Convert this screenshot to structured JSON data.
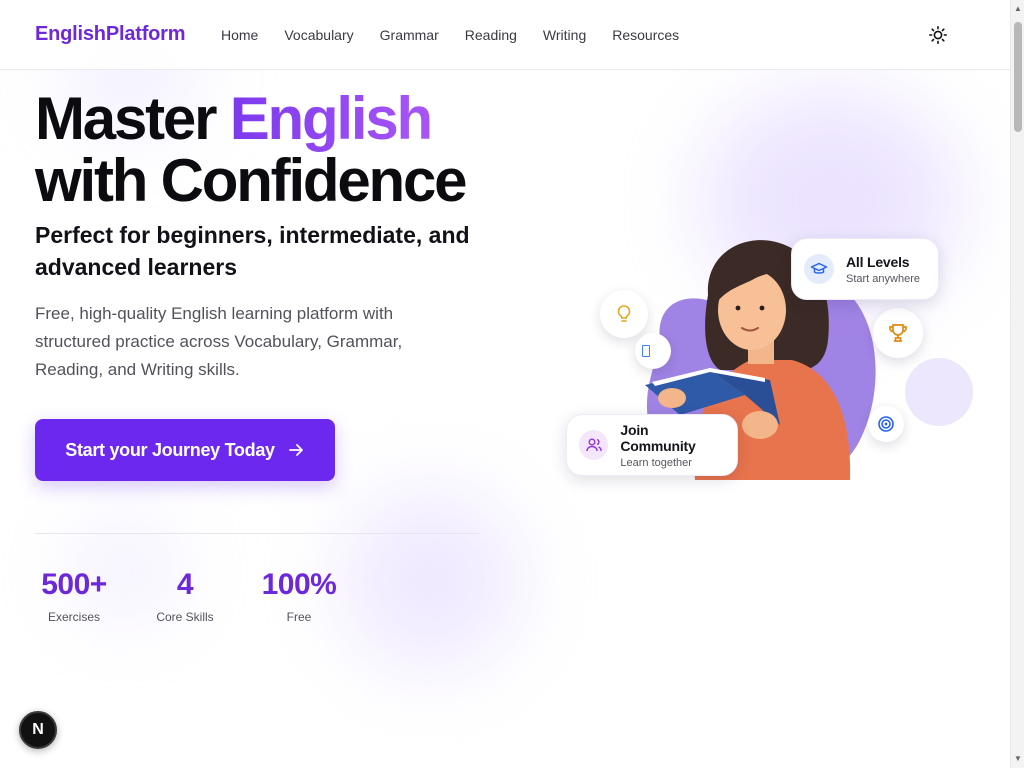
{
  "nav": {
    "brand": "EnglishPlatform",
    "links": [
      "Home",
      "Vocabulary",
      "Grammar",
      "Reading",
      "Writing",
      "Resources"
    ],
    "theme_toggle_icon": "sun-icon"
  },
  "hero": {
    "title_line1_plain": "Master ",
    "title_line1_accent": "English",
    "title_line2": "with Confidence",
    "subtitle": "Perfect for beginners, intermediate, and advanced learners",
    "description": "Free, high-quality English learning platform with structured practice across Vocabulary, Grammar, Reading, and Writing skills.",
    "cta_label": "Start your Journey Today",
    "cta_icon": "arrow-right-icon"
  },
  "stats": [
    {
      "value": "500+",
      "label": "Exercises"
    },
    {
      "value": "4",
      "label": "Core Skills"
    },
    {
      "value": "100%",
      "label": "Free"
    }
  ],
  "illustration": {
    "card_levels": {
      "title": "All Levels",
      "subtitle": "Start anywhere",
      "icon": "graduation-cap-icon"
    },
    "card_community": {
      "title": "Join Community",
      "subtitle": "Learn together",
      "icon": "users-icon"
    },
    "bubbles": [
      "lightbulb-icon",
      "trophy-icon",
      "target-icon"
    ]
  },
  "dev_indicator": "N",
  "colors": {
    "brand": "#6d28d9",
    "cta": "#6d28f0",
    "accent_gradient_start": "#7c3aed",
    "accent_gradient_end": "#a855f7"
  }
}
